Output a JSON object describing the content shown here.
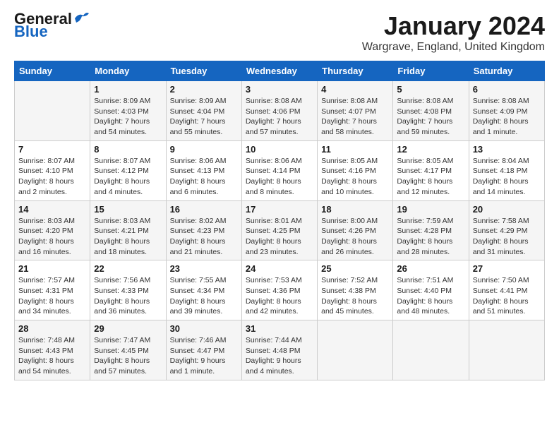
{
  "header": {
    "logo_general": "General",
    "logo_blue": "Blue",
    "month_year": "January 2024",
    "location": "Wargrave, England, United Kingdom"
  },
  "days_of_week": [
    "Sunday",
    "Monday",
    "Tuesday",
    "Wednesday",
    "Thursday",
    "Friday",
    "Saturday"
  ],
  "weeks": [
    [
      {
        "day": "",
        "detail": ""
      },
      {
        "day": "1",
        "detail": "Sunrise: 8:09 AM\nSunset: 4:03 PM\nDaylight: 7 hours\nand 54 minutes."
      },
      {
        "day": "2",
        "detail": "Sunrise: 8:09 AM\nSunset: 4:04 PM\nDaylight: 7 hours\nand 55 minutes."
      },
      {
        "day": "3",
        "detail": "Sunrise: 8:08 AM\nSunset: 4:06 PM\nDaylight: 7 hours\nand 57 minutes."
      },
      {
        "day": "4",
        "detail": "Sunrise: 8:08 AM\nSunset: 4:07 PM\nDaylight: 7 hours\nand 58 minutes."
      },
      {
        "day": "5",
        "detail": "Sunrise: 8:08 AM\nSunset: 4:08 PM\nDaylight: 7 hours\nand 59 minutes."
      },
      {
        "day": "6",
        "detail": "Sunrise: 8:08 AM\nSunset: 4:09 PM\nDaylight: 8 hours\nand 1 minute."
      }
    ],
    [
      {
        "day": "7",
        "detail": "Sunrise: 8:07 AM\nSunset: 4:10 PM\nDaylight: 8 hours\nand 2 minutes."
      },
      {
        "day": "8",
        "detail": "Sunrise: 8:07 AM\nSunset: 4:12 PM\nDaylight: 8 hours\nand 4 minutes."
      },
      {
        "day": "9",
        "detail": "Sunrise: 8:06 AM\nSunset: 4:13 PM\nDaylight: 8 hours\nand 6 minutes."
      },
      {
        "day": "10",
        "detail": "Sunrise: 8:06 AM\nSunset: 4:14 PM\nDaylight: 8 hours\nand 8 minutes."
      },
      {
        "day": "11",
        "detail": "Sunrise: 8:05 AM\nSunset: 4:16 PM\nDaylight: 8 hours\nand 10 minutes."
      },
      {
        "day": "12",
        "detail": "Sunrise: 8:05 AM\nSunset: 4:17 PM\nDaylight: 8 hours\nand 12 minutes."
      },
      {
        "day": "13",
        "detail": "Sunrise: 8:04 AM\nSunset: 4:18 PM\nDaylight: 8 hours\nand 14 minutes."
      }
    ],
    [
      {
        "day": "14",
        "detail": "Sunrise: 8:03 AM\nSunset: 4:20 PM\nDaylight: 8 hours\nand 16 minutes."
      },
      {
        "day": "15",
        "detail": "Sunrise: 8:03 AM\nSunset: 4:21 PM\nDaylight: 8 hours\nand 18 minutes."
      },
      {
        "day": "16",
        "detail": "Sunrise: 8:02 AM\nSunset: 4:23 PM\nDaylight: 8 hours\nand 21 minutes."
      },
      {
        "day": "17",
        "detail": "Sunrise: 8:01 AM\nSunset: 4:25 PM\nDaylight: 8 hours\nand 23 minutes."
      },
      {
        "day": "18",
        "detail": "Sunrise: 8:00 AM\nSunset: 4:26 PM\nDaylight: 8 hours\nand 26 minutes."
      },
      {
        "day": "19",
        "detail": "Sunrise: 7:59 AM\nSunset: 4:28 PM\nDaylight: 8 hours\nand 28 minutes."
      },
      {
        "day": "20",
        "detail": "Sunrise: 7:58 AM\nSunset: 4:29 PM\nDaylight: 8 hours\nand 31 minutes."
      }
    ],
    [
      {
        "day": "21",
        "detail": "Sunrise: 7:57 AM\nSunset: 4:31 PM\nDaylight: 8 hours\nand 34 minutes."
      },
      {
        "day": "22",
        "detail": "Sunrise: 7:56 AM\nSunset: 4:33 PM\nDaylight: 8 hours\nand 36 minutes."
      },
      {
        "day": "23",
        "detail": "Sunrise: 7:55 AM\nSunset: 4:34 PM\nDaylight: 8 hours\nand 39 minutes."
      },
      {
        "day": "24",
        "detail": "Sunrise: 7:53 AM\nSunset: 4:36 PM\nDaylight: 8 hours\nand 42 minutes."
      },
      {
        "day": "25",
        "detail": "Sunrise: 7:52 AM\nSunset: 4:38 PM\nDaylight: 8 hours\nand 45 minutes."
      },
      {
        "day": "26",
        "detail": "Sunrise: 7:51 AM\nSunset: 4:40 PM\nDaylight: 8 hours\nand 48 minutes."
      },
      {
        "day": "27",
        "detail": "Sunrise: 7:50 AM\nSunset: 4:41 PM\nDaylight: 8 hours\nand 51 minutes."
      }
    ],
    [
      {
        "day": "28",
        "detail": "Sunrise: 7:48 AM\nSunset: 4:43 PM\nDaylight: 8 hours\nand 54 minutes."
      },
      {
        "day": "29",
        "detail": "Sunrise: 7:47 AM\nSunset: 4:45 PM\nDaylight: 8 hours\nand 57 minutes."
      },
      {
        "day": "30",
        "detail": "Sunrise: 7:46 AM\nSunset: 4:47 PM\nDaylight: 9 hours\nand 1 minute."
      },
      {
        "day": "31",
        "detail": "Sunrise: 7:44 AM\nSunset: 4:48 PM\nDaylight: 9 hours\nand 4 minutes."
      },
      {
        "day": "",
        "detail": ""
      },
      {
        "day": "",
        "detail": ""
      },
      {
        "day": "",
        "detail": ""
      }
    ]
  ]
}
